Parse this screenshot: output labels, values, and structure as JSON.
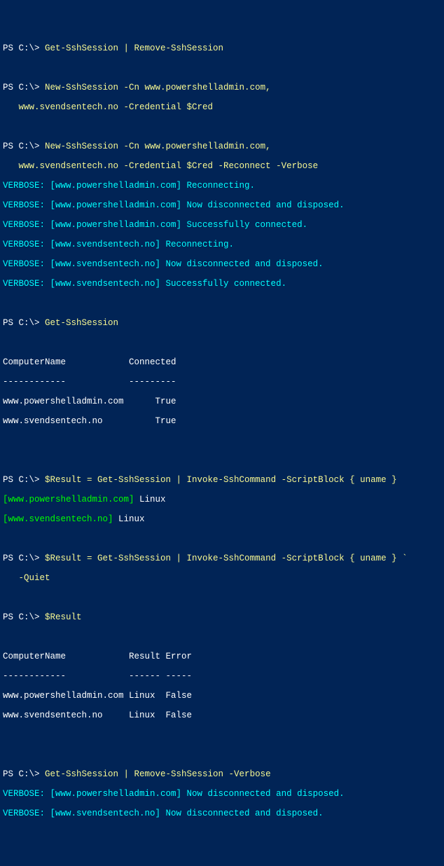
{
  "l1_a": "PS C:\\> ",
  "l1_b": "Get-SshSession | Remove-SshSession",
  "blank": " ",
  "l3_a": "PS C:\\> ",
  "l3_b": "New-SshSession -Cn www.powershelladmin.com,",
  "l4": "   www.svendsentech.no -Credential $Cred",
  "l6_a": "PS C:\\> ",
  "l6_b": "New-SshSession -Cn www.powershelladmin.com,",
  "l7": "   www.svendsentech.no -Credential $Cred -Reconnect -Verbose",
  "v1": "VERBOSE: [www.powershelladmin.com] Reconnecting.",
  "v2": "VERBOSE: [www.powershelladmin.com] Now disconnected and disposed.",
  "v3": "VERBOSE: [www.powershelladmin.com] Successfully connected.",
  "v4": "VERBOSE: [www.svendsentech.no] Reconnecting.",
  "v5": "VERBOSE: [www.svendsentech.no] Now disconnected and disposed.",
  "v6": "VERBOSE: [www.svendsentech.no] Successfully connected.",
  "l15_a": "PS C:\\> ",
  "l15_b": "Get-SshSession",
  "hdr1": "ComputerName            Connected",
  "hdr1u": "------------            ---------",
  "row1": "www.powershelladmin.com      True",
  "row2": "www.svendsentech.no          True",
  "l23_a": "PS C:\\> ",
  "l23_b": "$Result = Get-SshSession | Invoke-SshCommand -ScriptBlock { uname }",
  "g1_a": "[www.powershelladmin.com]",
  "g1_b": " Linux",
  "g2_a": "[www.svendsentech.no]",
  "g2_b": " Linux",
  "l27_a": "PS C:\\> ",
  "l27_b": "$Result = Get-SshSession | Invoke-SshCommand -ScriptBlock { uname } `",
  "l28": "   -Quiet",
  "l30_a": "PS C:\\> ",
  "l30_b": "$Result",
  "hdr2": "ComputerName            Result Error",
  "hdr2u": "------------            ------ -----",
  "row3": "www.powershelladmin.com Linux  False",
  "row4": "www.svendsentech.no     Linux  False",
  "l39_a": "PS C:\\> ",
  "l39_b": "Get-SshSession | Remove-SshSession -Verbose",
  "v7": "VERBOSE: [www.powershelladmin.com] Now disconnected and disposed.",
  "v8": "VERBOSE: [www.svendsentech.no] Now disconnected and disposed."
}
